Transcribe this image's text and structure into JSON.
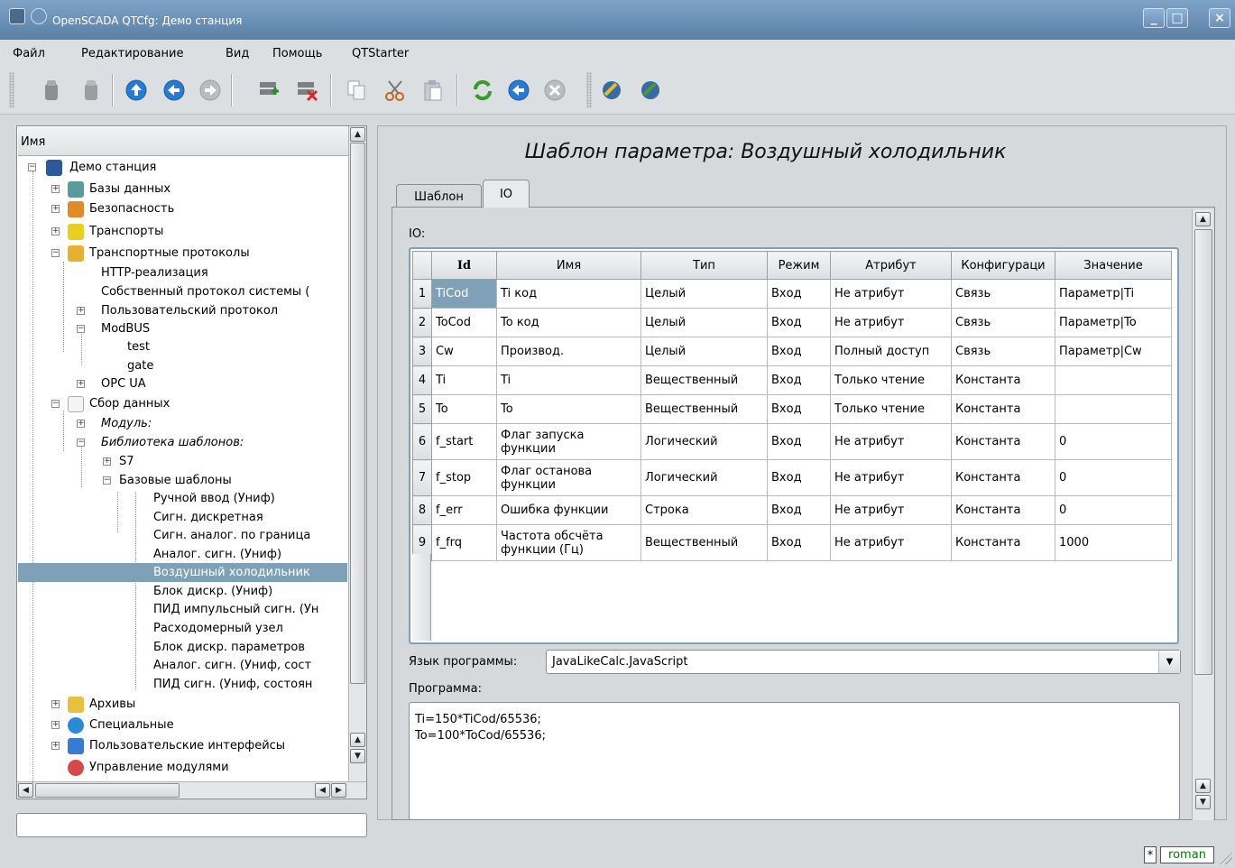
{
  "window": {
    "title": "OpenSCADA QTCfg: Демо станция"
  },
  "menu": [
    "Файл",
    "Редактирование",
    "Вид",
    "Помощь",
    "QTStarter"
  ],
  "tree": {
    "header": "Имя",
    "nodes": [
      {
        "label": "Демо станция",
        "italic": false
      },
      {
        "label": "Базы данных",
        "italic": false
      },
      {
        "label": "Безопасность",
        "italic": false
      },
      {
        "label": "Транспорты",
        "italic": false
      },
      {
        "label": "Транспортные протоколы",
        "italic": false
      },
      {
        "label": "HTTP-реализация",
        "italic": false
      },
      {
        "label": "Собственный протокол системы (",
        "italic": false
      },
      {
        "label": "Пользовательский протокол",
        "italic": false
      },
      {
        "label": "ModBUS",
        "italic": false
      },
      {
        "label": "test",
        "italic": false
      },
      {
        "label": "gate",
        "italic": false
      },
      {
        "label": "OPC UA",
        "italic": false
      },
      {
        "label": "Сбор данных",
        "italic": false
      },
      {
        "label": "Модуль:",
        "italic": true
      },
      {
        "label": "Библиотека шаблонов:",
        "italic": true
      },
      {
        "label": "S7",
        "italic": false
      },
      {
        "label": "Базовые шаблоны",
        "italic": false
      },
      {
        "label": "Ручной ввод (Униф)",
        "italic": false
      },
      {
        "label": "Сигн. дискретная",
        "italic": false
      },
      {
        "label": "Сигн. аналог. по граница",
        "italic": false
      },
      {
        "label": "Аналог. сигн. (Униф)",
        "italic": false
      },
      {
        "label": "Воздушный холодильник",
        "italic": false
      },
      {
        "label": "Блок дискр. (Униф)",
        "italic": false
      },
      {
        "label": "ПИД импульсный сигн. (Ун",
        "italic": false
      },
      {
        "label": "Расходомерный узел",
        "italic": false
      },
      {
        "label": "Блок дискр. параметров",
        "italic": false
      },
      {
        "label": "Аналог. сигн. (Униф, сост",
        "italic": false
      },
      {
        "label": "ПИД сигн. (Униф, состоян",
        "italic": false
      },
      {
        "label": "Архивы",
        "italic": false
      },
      {
        "label": "Специальные",
        "italic": false
      },
      {
        "label": "Пользовательские интерфейсы",
        "italic": false
      },
      {
        "label": "Управление модулями",
        "italic": false
      }
    ]
  },
  "page": {
    "title": "Шаблон параметра: Воздушный холодильник",
    "tabs": [
      "Шаблон",
      "IO"
    ],
    "io_label": "IO:",
    "columns": [
      "Id",
      "Имя",
      "Тип",
      "Режим",
      "Атрибут",
      "Конфигураци",
      "Значение"
    ],
    "rows": [
      [
        "1",
        "TiCod",
        "Ti код",
        "Целый",
        "Вход",
        "Не атрибут",
        "Связь",
        "Параметр|Ti"
      ],
      [
        "2",
        "ToCod",
        "To код",
        "Целый",
        "Вход",
        "Не атрибут",
        "Связь",
        "Параметр|To"
      ],
      [
        "3",
        "Cw",
        "Производ.",
        "Целый",
        "Вход",
        "Полный доступ",
        "Связь",
        "Параметр|Cw"
      ],
      [
        "4",
        "Ti",
        "Ti",
        "Вещественный",
        "Вход",
        "Только чтение",
        "Константа",
        ""
      ],
      [
        "5",
        "To",
        "To",
        "Вещественный",
        "Вход",
        "Только чтение",
        "Константа",
        ""
      ],
      [
        "6",
        "f_start",
        "Флаг запуска функции",
        "Логический",
        "Вход",
        "Не атрибут",
        "Константа",
        "0"
      ],
      [
        "7",
        "f_stop",
        "Флаг останова функции",
        "Логический",
        "Вход",
        "Не атрибут",
        "Константа",
        "0"
      ],
      [
        "8",
        "f_err",
        "Ошибка функции",
        "Строка",
        "Вход",
        "Не атрибут",
        "Константа",
        "0"
      ],
      [
        "9",
        "f_frq",
        "Частота обсчёта функции (Гц)",
        "Вещественный",
        "Вход",
        "Не атрибут",
        "Константа",
        "1000"
      ]
    ],
    "lang_label": "Язык программы:",
    "lang_value": "JavaLikeCalc.JavaScript",
    "program_label": "Программа:",
    "program": "Ti=150*TiCod/65536;\nTo=100*ToCod/65536;"
  },
  "status": {
    "modified": "*",
    "user": "roman"
  }
}
